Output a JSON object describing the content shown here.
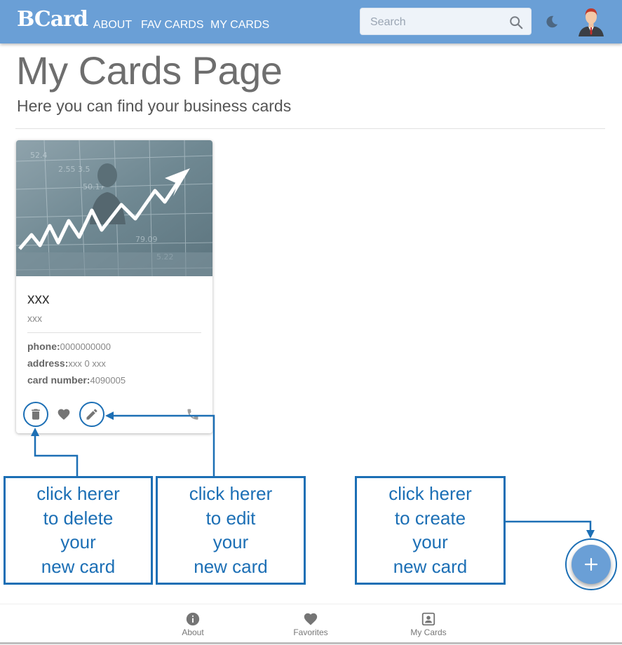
{
  "header": {
    "logo": "BCard",
    "nav": [
      {
        "label": "ABOUT"
      },
      {
        "label": "FAV CARDS"
      },
      {
        "label": "MY CARDS"
      }
    ],
    "search": {
      "placeholder": "Search",
      "value": ""
    },
    "brand_color": "#6a9fd6"
  },
  "page": {
    "title": "My Cards Page",
    "subtitle": "Here you can find your business cards"
  },
  "card": {
    "title": "xxx",
    "subtitle": "xxx",
    "phone_label": "phone:",
    "phone_value": "0000000000",
    "address_label": "address:",
    "address_value": "xxx 0 xxx",
    "card_number_label": "card number:",
    "card_number_value": "4090005",
    "actions": [
      "delete-icon",
      "heart-icon",
      "edit-icon",
      "phone-icon"
    ]
  },
  "annotations": {
    "delete": [
      "click herer",
      "to delete",
      "your",
      "new card"
    ],
    "edit": [
      "click herer",
      "to edit",
      "your",
      "new card"
    ],
    "create": [
      "click herer",
      "to create",
      "your",
      "new card"
    ],
    "accent_color": "#1c6fb5"
  },
  "bottom_nav": [
    {
      "label": "About",
      "icon": "info-icon"
    },
    {
      "label": "Favorites",
      "icon": "heart-icon"
    },
    {
      "label": "My Cards",
      "icon": "contact-card-icon"
    }
  ]
}
